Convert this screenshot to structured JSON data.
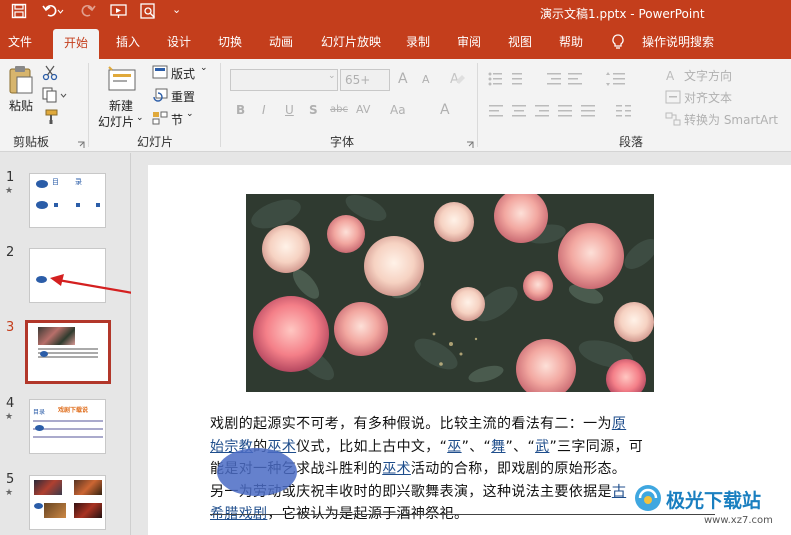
{
  "window": {
    "title": "演示文稿1.pptx  -  PowerPoint"
  },
  "quick_access": {
    "save_icon": "save-icon",
    "undo_icon": "undo-icon",
    "redo_icon": "redo-icon",
    "present_icon": "present-icon",
    "preview_icon": "preview-icon",
    "more": "⌄"
  },
  "tabs": [
    {
      "label": "文件"
    },
    {
      "label": "开始"
    },
    {
      "label": "插入"
    },
    {
      "label": "设计"
    },
    {
      "label": "切换"
    },
    {
      "label": "动画"
    },
    {
      "label": "幻灯片放映"
    },
    {
      "label": "录制"
    },
    {
      "label": "审阅"
    },
    {
      "label": "视图"
    },
    {
      "label": "帮助"
    },
    {
      "label": "操作说明搜索"
    }
  ],
  "ribbon": {
    "clipboard": {
      "paste": "粘贴",
      "group": "剪贴板"
    },
    "slides": {
      "new_slide": "新建",
      "new_slide2": "幻灯片",
      "layout": "版式",
      "reset": "重置",
      "section": "节",
      "group": "幻灯片"
    },
    "font": {
      "size": "65+",
      "bold": "B",
      "italic": "I",
      "underline": "U",
      "shadow": "S",
      "strike": "abc",
      "spacing": "AV",
      "case": "Aa",
      "color": "A",
      "grow": "A",
      "shrink": "A",
      "group": "字体"
    },
    "paragraph": {
      "text_direction": "文字方向",
      "align_text": "对齐文本",
      "smartart": "转换为 SmartArt",
      "group": "段落"
    }
  },
  "thumbnails": [
    {
      "num": "1",
      "star": "★",
      "text_a": "目",
      "text_b": "录"
    },
    {
      "num": "2",
      "star": ""
    },
    {
      "num": "3",
      "star": ""
    },
    {
      "num": "4",
      "star": "★",
      "heading": "戏剧下载说",
      "label": "目录"
    },
    {
      "num": "5",
      "star": "★"
    }
  ],
  "slide": {
    "body": {
      "l1a": "戏剧的起源实不可考，有多种假说。比较主流的看法有二：一为",
      "l1link": "原",
      "l2link": "始宗教",
      "l2a": "的",
      "l2link2": "巫术",
      "l2b": "仪式，比如上古中文，“",
      "l2w1": "巫",
      "l2c": "”、“",
      "l2w2": "舞",
      "l2d": "”、“",
      "l2w3": "武",
      "l2e": "”三字同源，可",
      "l3a": "能是对一种乞求战斗胜利的",
      "l3link": "巫术",
      "l3b": "活动的合称，即戏剧的原始形态。",
      "l4a": "另一为劳动或庆祝丰收时的即兴歌舞表演，这种说法主要依据是",
      "l4link": "古",
      "l5link": "希腊戏剧",
      "l5a": "，它被认为是起源于酒神祭祀。"
    }
  },
  "watermark": {
    "text": "极光下载站",
    "url": "www.xz7.com"
  },
  "colors": {
    "accent": "#c43e1c",
    "link": "#1f4e8c",
    "arrow": "#d42020",
    "ellipse": "#4a6bc4"
  }
}
